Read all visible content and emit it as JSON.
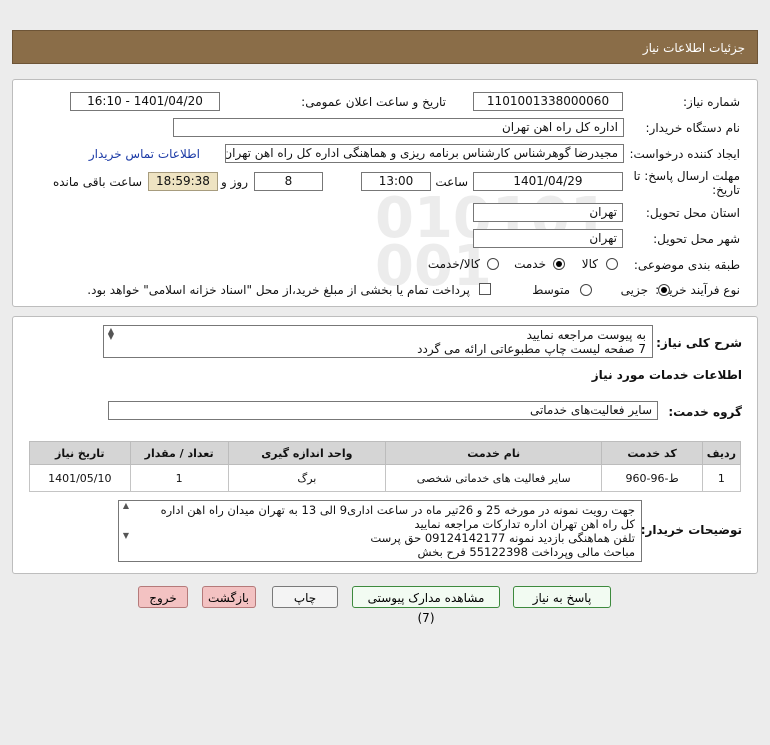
{
  "header": {
    "title": "جزئیات اطلاعات نیاز"
  },
  "form": {
    "need_number_label": "شماره نیاز:",
    "need_number": "1101001338000060",
    "announce_label": "تاریخ و ساعت اعلان عمومی:",
    "announce_value": "1401/04/20 - 16:10",
    "buyer_org_label": "نام دستگاه خریدار:",
    "buyer_org": "اداره کل راه اهن تهران",
    "creator_label": "ایجاد کننده درخواست:",
    "creator": "مجیدرضا گوهرشناس کارشناس برنامه ریزی و هماهنگی اداره کل راه اهن تهران",
    "contact_link": "اطلاعات تماس خریدار",
    "deadline_label_1": "مهلت ارسال پاسخ: تا",
    "deadline_label_2": "تاریخ:",
    "deadline_date": "1401/04/29",
    "hour_label": "ساعت",
    "deadline_hour": "13:00",
    "days_value": "8",
    "days_label": "روز و",
    "remaining_time": "18:59:38",
    "remaining_label": "ساعت باقی مانده",
    "province_label": "استان محل تحویل:",
    "province": "تهران",
    "city_label": "شهر محل تحویل:",
    "city": "تهران",
    "category_label": "طبقه بندی موضوعی:",
    "category_options": [
      "کالا",
      "خدمت",
      "کالا/خدمت"
    ],
    "category_selected": "خدمت",
    "purchase_type_label": "نوع فرآیند خرید :",
    "purchase_options": [
      "جزیی",
      "متوسط"
    ],
    "purchase_selected": "جزیی",
    "payment_note": "پرداخت تمام یا بخشی از مبلغ خرید،از محل \"اسناد خزانه اسلامی\" خواهد بود."
  },
  "description": {
    "label": "شرح کلی نیاز:",
    "lines": [
      "به پیوست مراجعه نمایید",
      "7 صفحه لیست چاپ مطبوعاتی ارائه می گردد"
    ]
  },
  "services": {
    "section_title": "اطلاعات خدمات مورد نیاز",
    "group_label": "گروه خدمت:",
    "group_value": "سایر فعالیت‌های خدماتی",
    "columns": [
      "ردیف",
      "کد خدمت",
      "نام خدمت",
      "واحد اندازه گیری",
      "تعداد / مقدار",
      "تاریخ نیاز"
    ],
    "rows": [
      [
        "1",
        "ط-96-960",
        "سایر فعالیت های خدماتی شخصی",
        "برگ",
        "1",
        "1401/05/10"
      ]
    ]
  },
  "buyer_notes": {
    "label": "توضیحات خریدار:",
    "lines": [
      "جهت رویت نمونه در مورخه 25 و 26تیر ماه در ساعت اداری9 الی 13  به تهران میدان راه اهن  اداره",
      "کل راه اهن تهران اداره تدارکات مراجعه نمایید",
      "تلفن هماهنگی بازدید نمونه 09124142177 حق پرست",
      "مباحث مالی وپرداخت 55122398 فرح بخش"
    ]
  },
  "buttons": {
    "reply": "پاسخ به نیاز",
    "attachments": "مشاهده مدارک پیوستی (7)",
    "print": "چاپ",
    "back": "بازگشت",
    "exit": "خروج"
  }
}
